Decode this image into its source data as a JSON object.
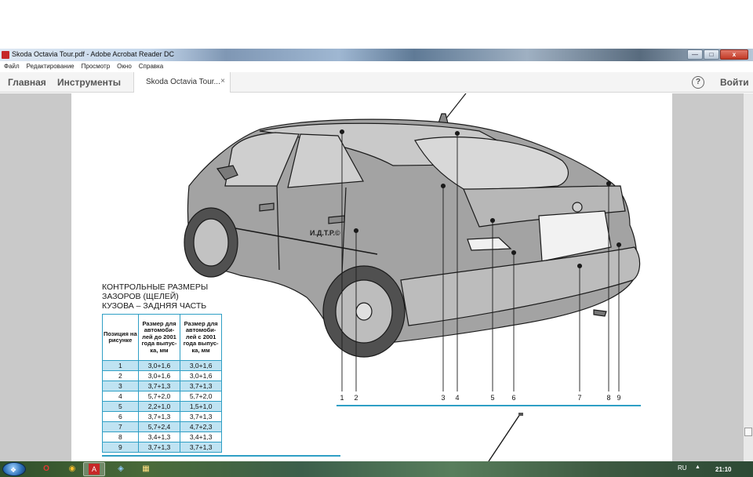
{
  "window": {
    "title": "Skoda Octavia Tour.pdf - Adobe Acrobat Reader DC",
    "minimize_icon": "minimize-icon",
    "maximize_icon": "maximize-icon",
    "close_symbol": "x"
  },
  "menu": [
    "Файл",
    "Редактирование",
    "Просмотр",
    "Окно",
    "Справка"
  ],
  "toolbar": {
    "home": "Главная",
    "tools": "Инструменты",
    "doc_tab": "Skoda Octavia Tour...",
    "doc_tab_close": "×",
    "help": "?",
    "signin": "Войти"
  },
  "document": {
    "heading": [
      "КОНТРОЛЬНЫЕ РАЗМЕРЫ",
      "ЗАЗОРОВ (ЩЕЛЕЙ)",
      "КУЗОВА – ЗАДНЯЯ ЧАСТЬ"
    ],
    "watermark": "И.Д.Т.Р.©",
    "table": {
      "headers": [
        "Позиция на рисунке",
        "Размер для автомоби-лей до 2001 года выпус-ка, мм",
        "Размер для автомоби-лей с 2001 года выпус-ка, мм"
      ],
      "rows": [
        [
          "1",
          "3,0+1,6",
          "3,0+1,6"
        ],
        [
          "2",
          "3,0+1,6",
          "3,0+1,6"
        ],
        [
          "3",
          "3,7+1,3",
          "3,7+1,3"
        ],
        [
          "4",
          "5,7+2,0",
          "5,7+2,0"
        ],
        [
          "5",
          "2,2+1,0",
          "1,5+1,0"
        ],
        [
          "6",
          "3,7+1,3",
          "3,7+1,3"
        ],
        [
          "7",
          "5,7+2,4",
          "4,7+2,3"
        ],
        [
          "8",
          "3,4+1,3",
          "3,4+1,3"
        ],
        [
          "9",
          "3,7+1,3",
          "3,7+1,3"
        ]
      ]
    },
    "callouts": [
      "1",
      "2",
      "3",
      "4",
      "5",
      "6",
      "7",
      "8",
      "9"
    ],
    "accent_color": "#2f9fc5"
  },
  "taskbar": {
    "items": [
      "start-icon",
      "opera-icon",
      "chrome-icon",
      "acrobat-icon",
      "browser-icon",
      "explorer-icon"
    ],
    "language": "RU",
    "time": "21:10"
  }
}
